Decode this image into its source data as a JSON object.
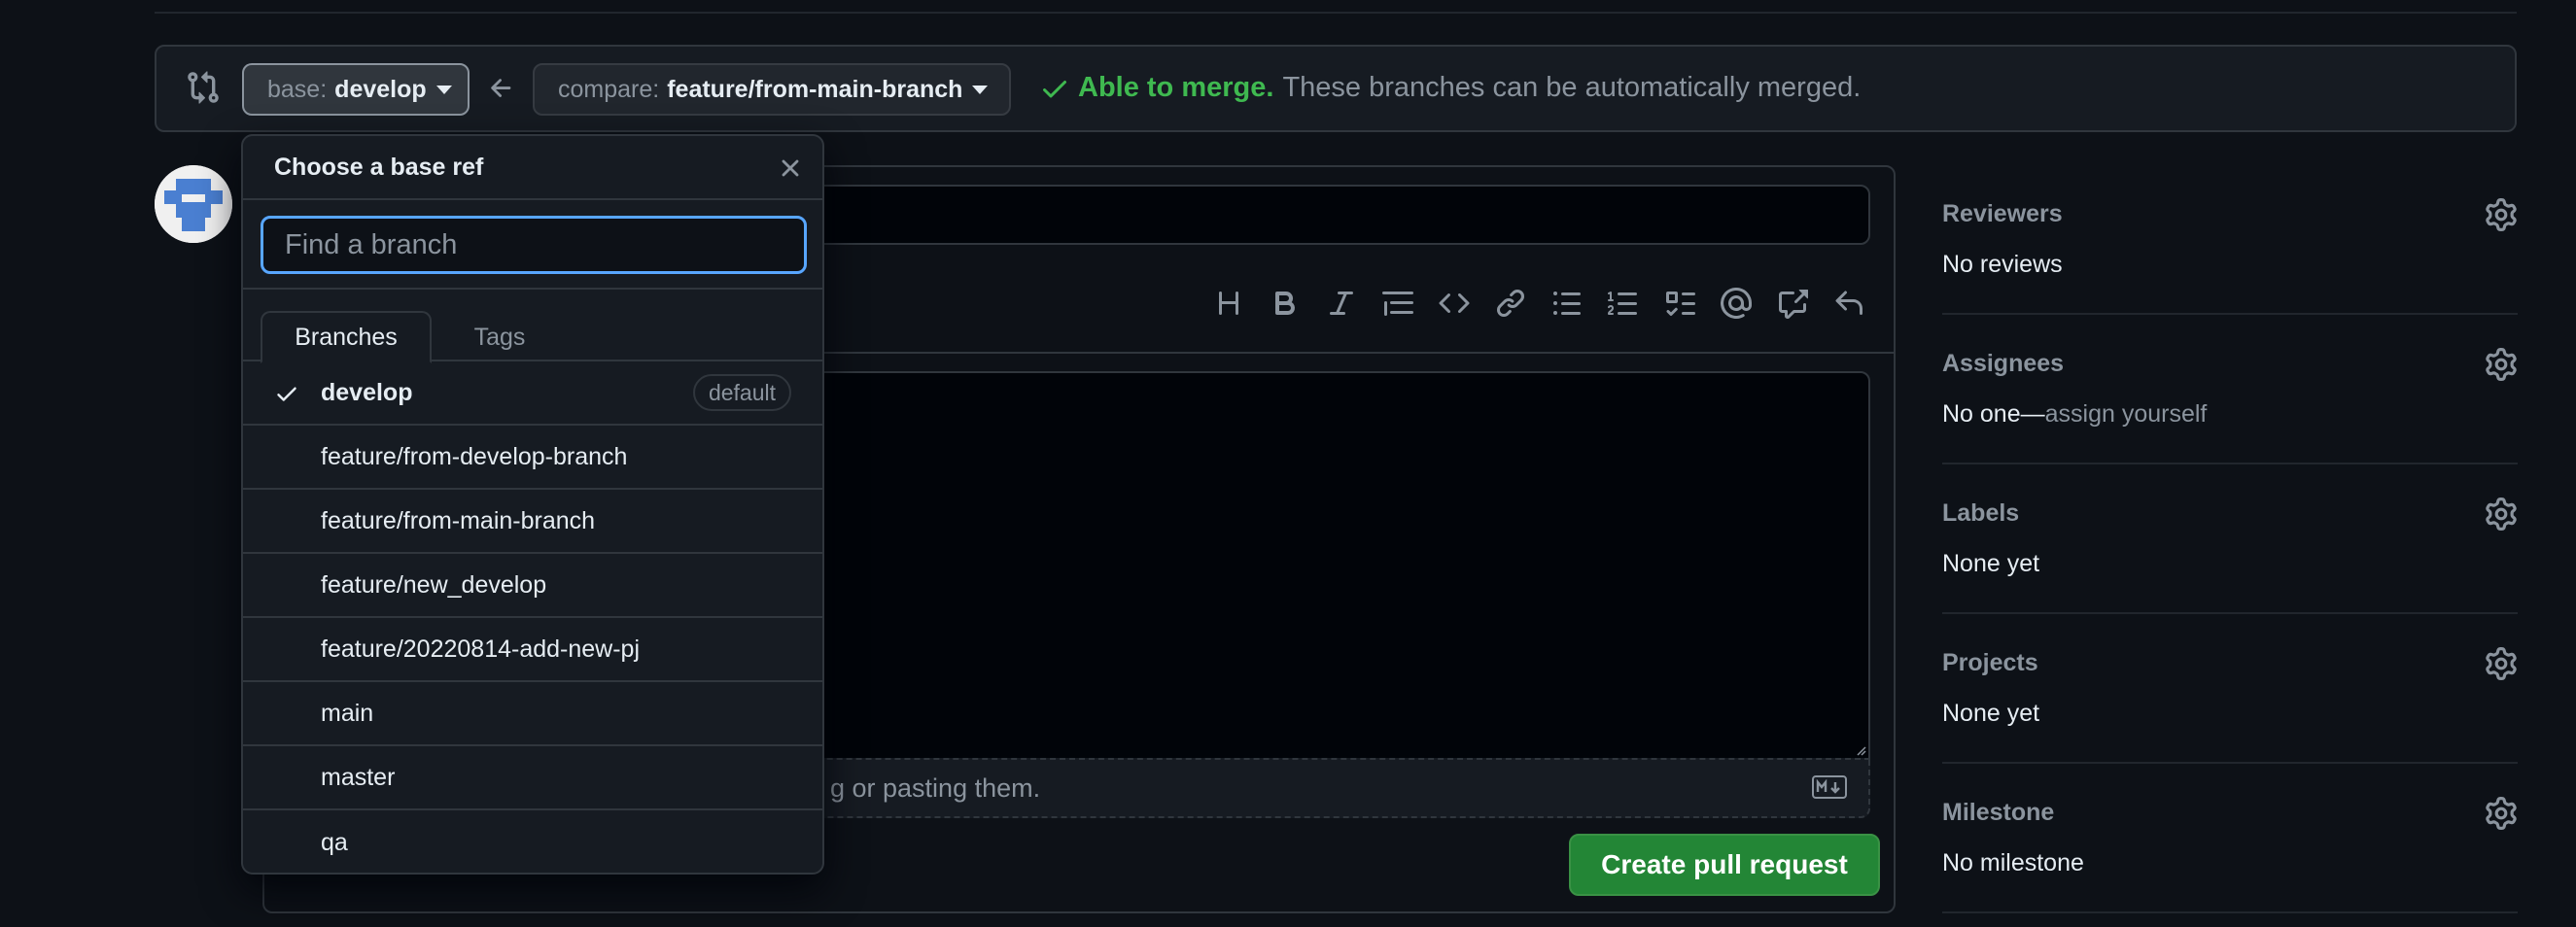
{
  "compare_bar": {
    "base_prefix": "base:",
    "base_value": "develop",
    "compare_prefix": "compare:",
    "compare_value": "feature/from-main-branch",
    "merge_ok": "Able to merge.",
    "merge_text": "These branches can be automatically merged."
  },
  "editor": {
    "attach_text": "g or pasting them.",
    "create_label": "Create pull request",
    "toolbar_icons": [
      "heading-icon",
      "bold-icon",
      "italic-icon",
      "quote-icon",
      "code-icon",
      "link-icon",
      "unordered-list-icon",
      "ordered-list-icon",
      "task-list-icon",
      "mention-icon",
      "cross-reference-icon",
      "reply-icon"
    ]
  },
  "sidebar": {
    "reviewers_title": "Reviewers",
    "reviewers_value": "No reviews",
    "assignees_title": "Assignees",
    "assignees_value": "No one—",
    "assignees_link": "assign yourself",
    "labels_title": "Labels",
    "labels_value": "None yet",
    "projects_title": "Projects",
    "projects_value": "None yet",
    "milestone_title": "Milestone",
    "milestone_value": "No milestone"
  },
  "dropdown": {
    "title": "Choose a base ref",
    "filter_placeholder": "Find a branch",
    "tab_branches": "Branches",
    "tab_tags": "Tags",
    "default_badge": "default",
    "branches": [
      "develop",
      "feature/from-develop-branch",
      "feature/from-main-branch",
      "feature/new_develop",
      "feature/20220814-add-new-pj",
      "main",
      "master",
      "qa"
    ]
  },
  "colors": {
    "accent_green": "#3fb950",
    "button_green": "#238636",
    "focus_blue": "#58a6ff"
  }
}
